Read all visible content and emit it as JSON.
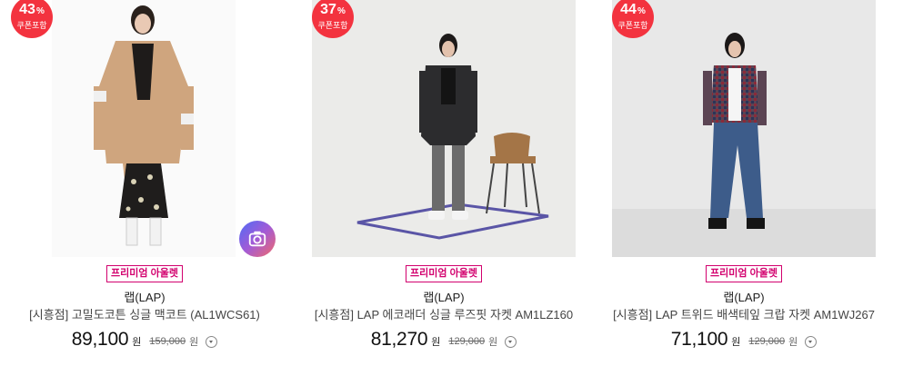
{
  "products": [
    {
      "discount": "43",
      "discount_unit": "%",
      "coupon_label": "쿠폰포함",
      "tag": "프리미엄 아울렛",
      "brand": "랩(LAP)",
      "name": "[시흥점] 고밀도코튼 싱글 맥코트 (AL1WCS61)",
      "price": "89,100",
      "price_unit": "원",
      "original_price": "159,000",
      "original_unit": "원",
      "has_camera_icon": true
    },
    {
      "discount": "37",
      "discount_unit": "%",
      "coupon_label": "쿠폰포함",
      "tag": "프리미엄 아울렛",
      "brand": "랩(LAP)",
      "name": "[시흥점] LAP 에코래더 싱글 루즈핏 자켓 AM1LZ160",
      "price": "81,270",
      "price_unit": "원",
      "original_price": "129,000",
      "original_unit": "원",
      "has_camera_icon": false
    },
    {
      "discount": "44",
      "discount_unit": "%",
      "coupon_label": "쿠폰포함",
      "tag": "프리미엄 아울렛",
      "brand": "랩(LAP)",
      "name": "[시흥점] LAP 트위드 배색테잎 크랍 자켓 AM1WJ267",
      "price": "71,100",
      "price_unit": "원",
      "original_price": "129,000",
      "original_unit": "원",
      "has_camera_icon": false
    }
  ],
  "colors": {
    "badge": "#f3333f",
    "tag": "#d2006e"
  }
}
